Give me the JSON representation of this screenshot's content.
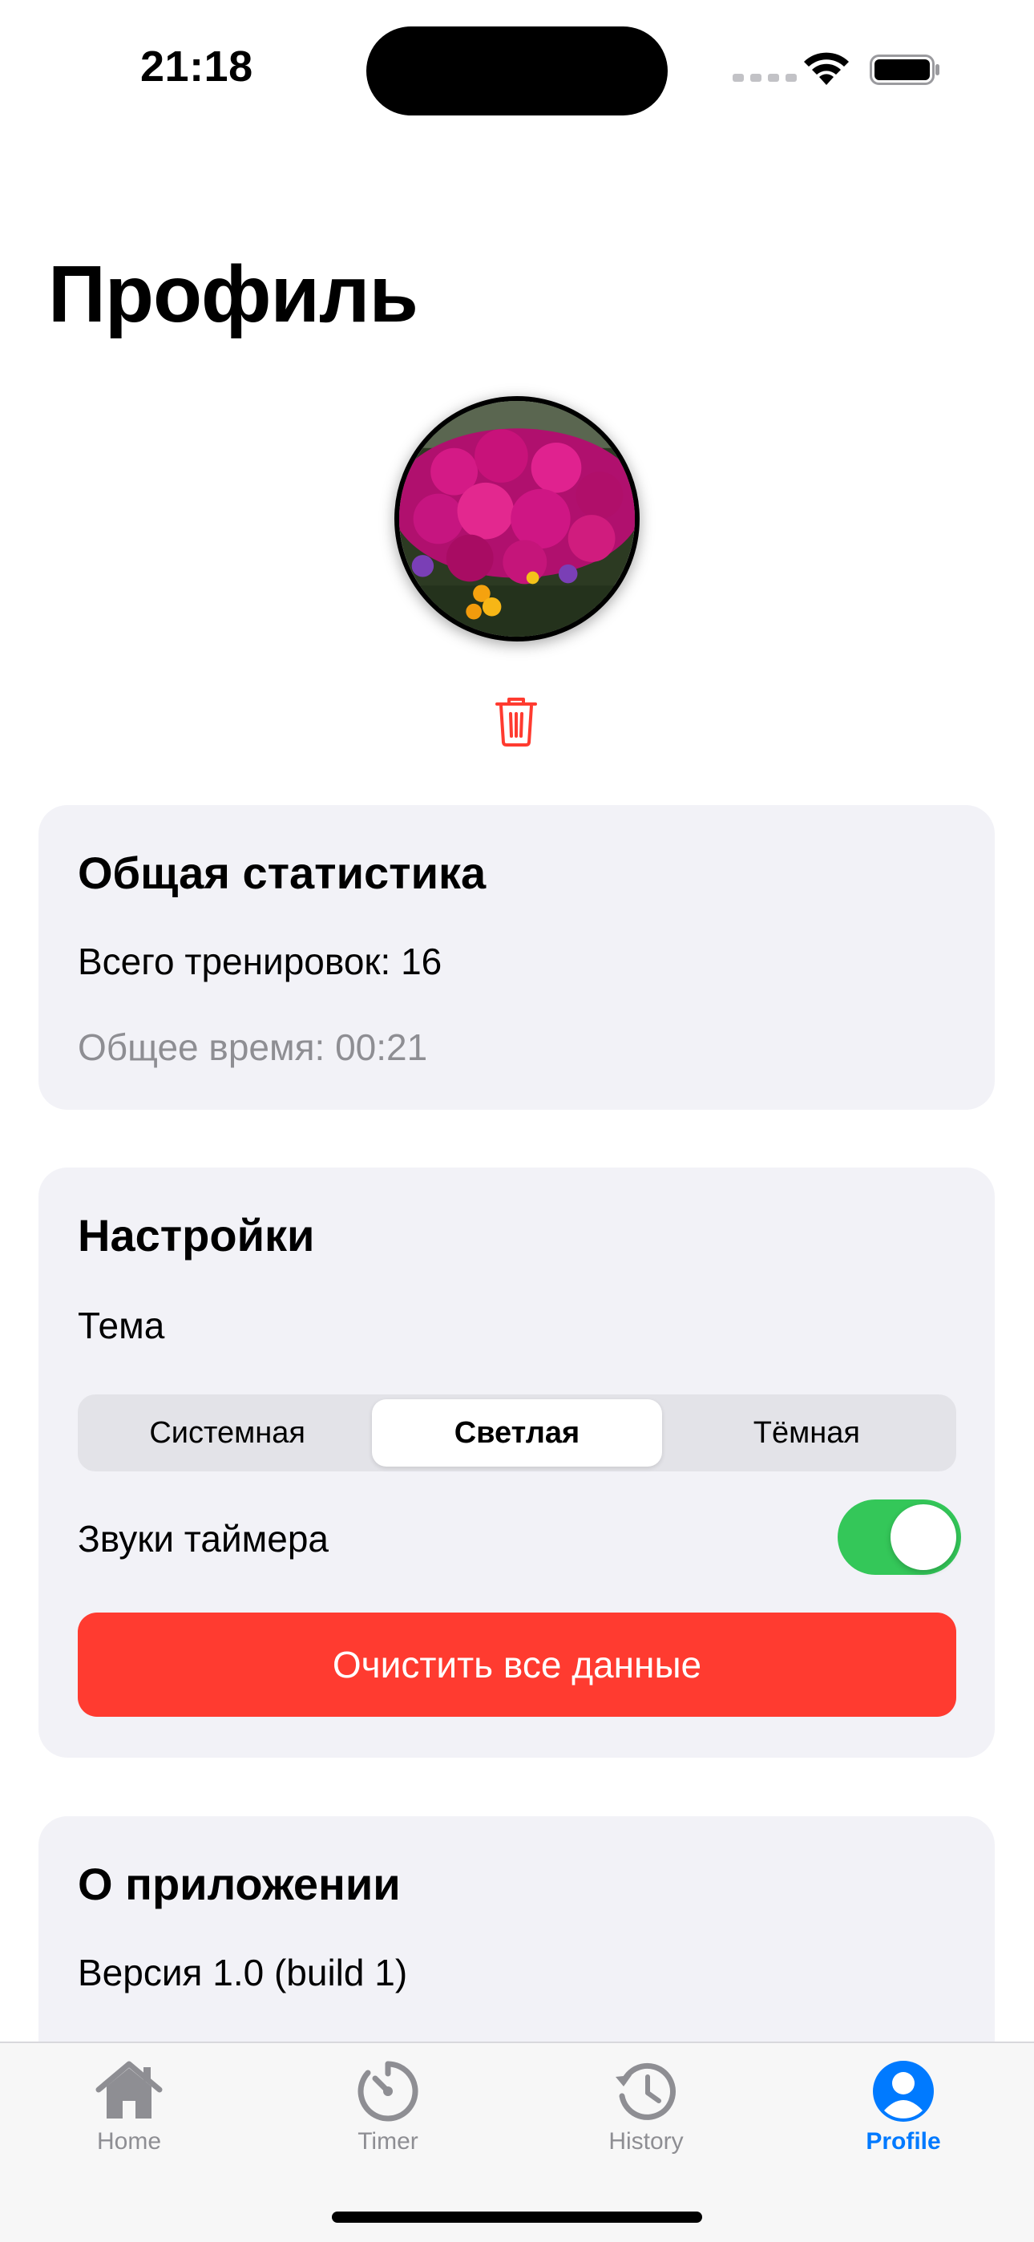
{
  "status_bar": {
    "time": "21:18"
  },
  "header": {
    "title": "Профиль"
  },
  "stats": {
    "title": "Общая статистика",
    "total_workouts": "Всего тренировок: 16",
    "total_time": "Общее время: 00:21"
  },
  "settings": {
    "title": "Настройки",
    "theme_label": "Тема",
    "theme_options": [
      "Системная",
      "Светлая",
      "Тёмная"
    ],
    "theme_selected": "Светлая",
    "sounds_label": "Звуки таймера",
    "sounds_enabled": true,
    "clear_button": "Очистить все данные"
  },
  "about": {
    "title": "О приложении",
    "version": "Версия 1.0 (build 1)"
  },
  "tabbar": {
    "items": [
      {
        "label": "Home",
        "icon": "house-icon"
      },
      {
        "label": "Timer",
        "icon": "timer-icon"
      },
      {
        "label": "History",
        "icon": "history-icon"
      },
      {
        "label": "Profile",
        "icon": "person-circle-icon",
        "active": true
      }
    ]
  },
  "colors": {
    "accent": "#007aff",
    "destructive": "#ff3b30",
    "toggle_on": "#34c759",
    "card_background": "#f2f2f7"
  }
}
